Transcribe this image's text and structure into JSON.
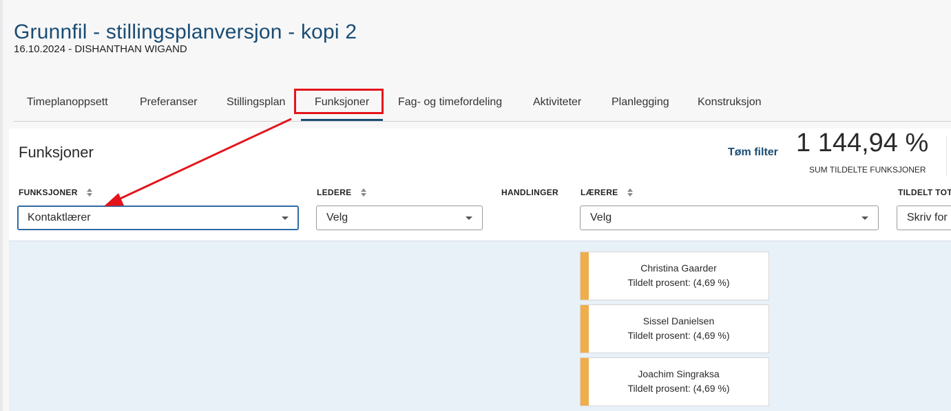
{
  "header": {
    "title": "Grunnfil - stillingsplanversjon - kopi 2",
    "subtitle": "16.10.2024 - DISHANTHAN WIGAND"
  },
  "tabs": [
    {
      "label": "Timeplanoppsett"
    },
    {
      "label": "Preferanser"
    },
    {
      "label": "Stillingsplan"
    },
    {
      "label": "Funksjoner",
      "active": true
    },
    {
      "label": "Fag- og timefordeling"
    },
    {
      "label": "Aktiviteter"
    },
    {
      "label": "Planlegging"
    },
    {
      "label": "Konstruksjon"
    }
  ],
  "panel": {
    "title": "Funksjoner",
    "clear_filter_label": "Tøm filter",
    "sum_value": "1 144,94 %",
    "sum_label": "SUM TILDELTE FUNKSJONER"
  },
  "filters": {
    "funksjoner": {
      "header": "FUNKSJONER",
      "value": "Kontaktlærer"
    },
    "ledere": {
      "header": "LEDERE",
      "value": "Velg"
    },
    "handlinger": {
      "header": "HANDLINGER"
    },
    "laerere": {
      "header": "LÆRERE",
      "value": "Velg"
    },
    "tildelt": {
      "header": "TILDELT TOT",
      "value": "Skriv for"
    }
  },
  "cards": [
    {
      "name": "Christina Gaarder",
      "percent_text": "Tildelt prosent: (4,69 %)"
    },
    {
      "name": "Sissel Danielsen",
      "percent_text": "Tildelt prosent: (4,69 %)"
    },
    {
      "name": "Joachim Singraksa",
      "percent_text": "Tildelt prosent: (4,69 %)"
    }
  ],
  "colors": {
    "brand": "#1a4c73",
    "annotation_red": "#e4141b",
    "card_accent": "#efad4b",
    "content_background": "#e8f0f8"
  },
  "icons": {
    "sort": "sort-icon",
    "caret": "chevron-down-icon",
    "annotation": "red-arrow-icon"
  }
}
